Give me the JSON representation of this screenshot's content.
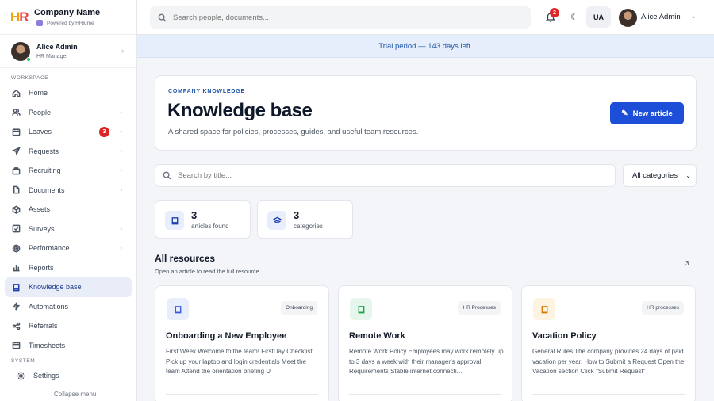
{
  "brand": {
    "company": "Company Name",
    "powered": "Powered by HRiume"
  },
  "user": {
    "name": "Alice Admin",
    "role": "HR Manager"
  },
  "sidebar": {
    "workspace_label": "WORKSPACE",
    "system_label": "SYSTEM",
    "items": [
      {
        "label": "Home",
        "icon": "home-icon"
      },
      {
        "label": "People",
        "icon": "people-icon"
      },
      {
        "label": "Leaves",
        "icon": "calendar-icon",
        "badge": "3"
      },
      {
        "label": "Requests",
        "icon": "send-icon"
      },
      {
        "label": "Recruiting",
        "icon": "briefcase-icon"
      },
      {
        "label": "Documents",
        "icon": "document-icon"
      },
      {
        "label": "Assets",
        "icon": "box-icon"
      },
      {
        "label": "Surveys",
        "icon": "checkbox-icon"
      },
      {
        "label": "Performance",
        "icon": "target-icon"
      },
      {
        "label": "Reports",
        "icon": "bar-chart-icon"
      },
      {
        "label": "Knowledge base",
        "icon": "book-icon",
        "active": true
      },
      {
        "label": "Automations",
        "icon": "bolt-icon"
      },
      {
        "label": "Referrals",
        "icon": "share-icon"
      },
      {
        "label": "Timesheets",
        "icon": "calendar-icon"
      }
    ],
    "settings": "Settings",
    "collapse": "Collapse menu"
  },
  "topbar": {
    "search_placeholder": "Search people, documents...",
    "notifications": "2",
    "lang": "UA",
    "user_name": "Alice Admin"
  },
  "trial_banner": "Trial period — 143 days left.",
  "hero": {
    "eyebrow": "COMPANY KNOWLEDGE",
    "title": "Knowledge base",
    "description": "A shared space for policies, processes, guides, and useful team resources.",
    "new_button": "New article"
  },
  "filters": {
    "search_placeholder": "Search by title...",
    "category": "All categories"
  },
  "stats": [
    {
      "value": "3",
      "label": "articles found"
    },
    {
      "value": "3",
      "label": "categories"
    }
  ],
  "resources": {
    "title": "All resources",
    "subtitle": "Open an article to read the full resource",
    "count": "3",
    "cards": [
      {
        "tag": "Onboarding",
        "title": "Onboarding a New Employee",
        "body": "First Week Welcome to the team! FirstDay Checklist Pick up your laptop and login credentials Meet the team Attend the orientation briefing U",
        "color": "#3b5bdb"
      },
      {
        "tag": "HR Processes",
        "title": "Remote Work",
        "body": "Remote Work Policy Employees may work remotely up to 3 days a week with their manager's approval. Requirements Stable internet connecti...",
        "color": "#16a34a"
      },
      {
        "tag": "HR processes",
        "title": "Vacation Policy",
        "body": "General Rules The company provides 24 days of paid vacation per year. How to Submit a Request Open the Vacation section Click \"Submit Request\"",
        "color": "#d97706"
      }
    ]
  }
}
